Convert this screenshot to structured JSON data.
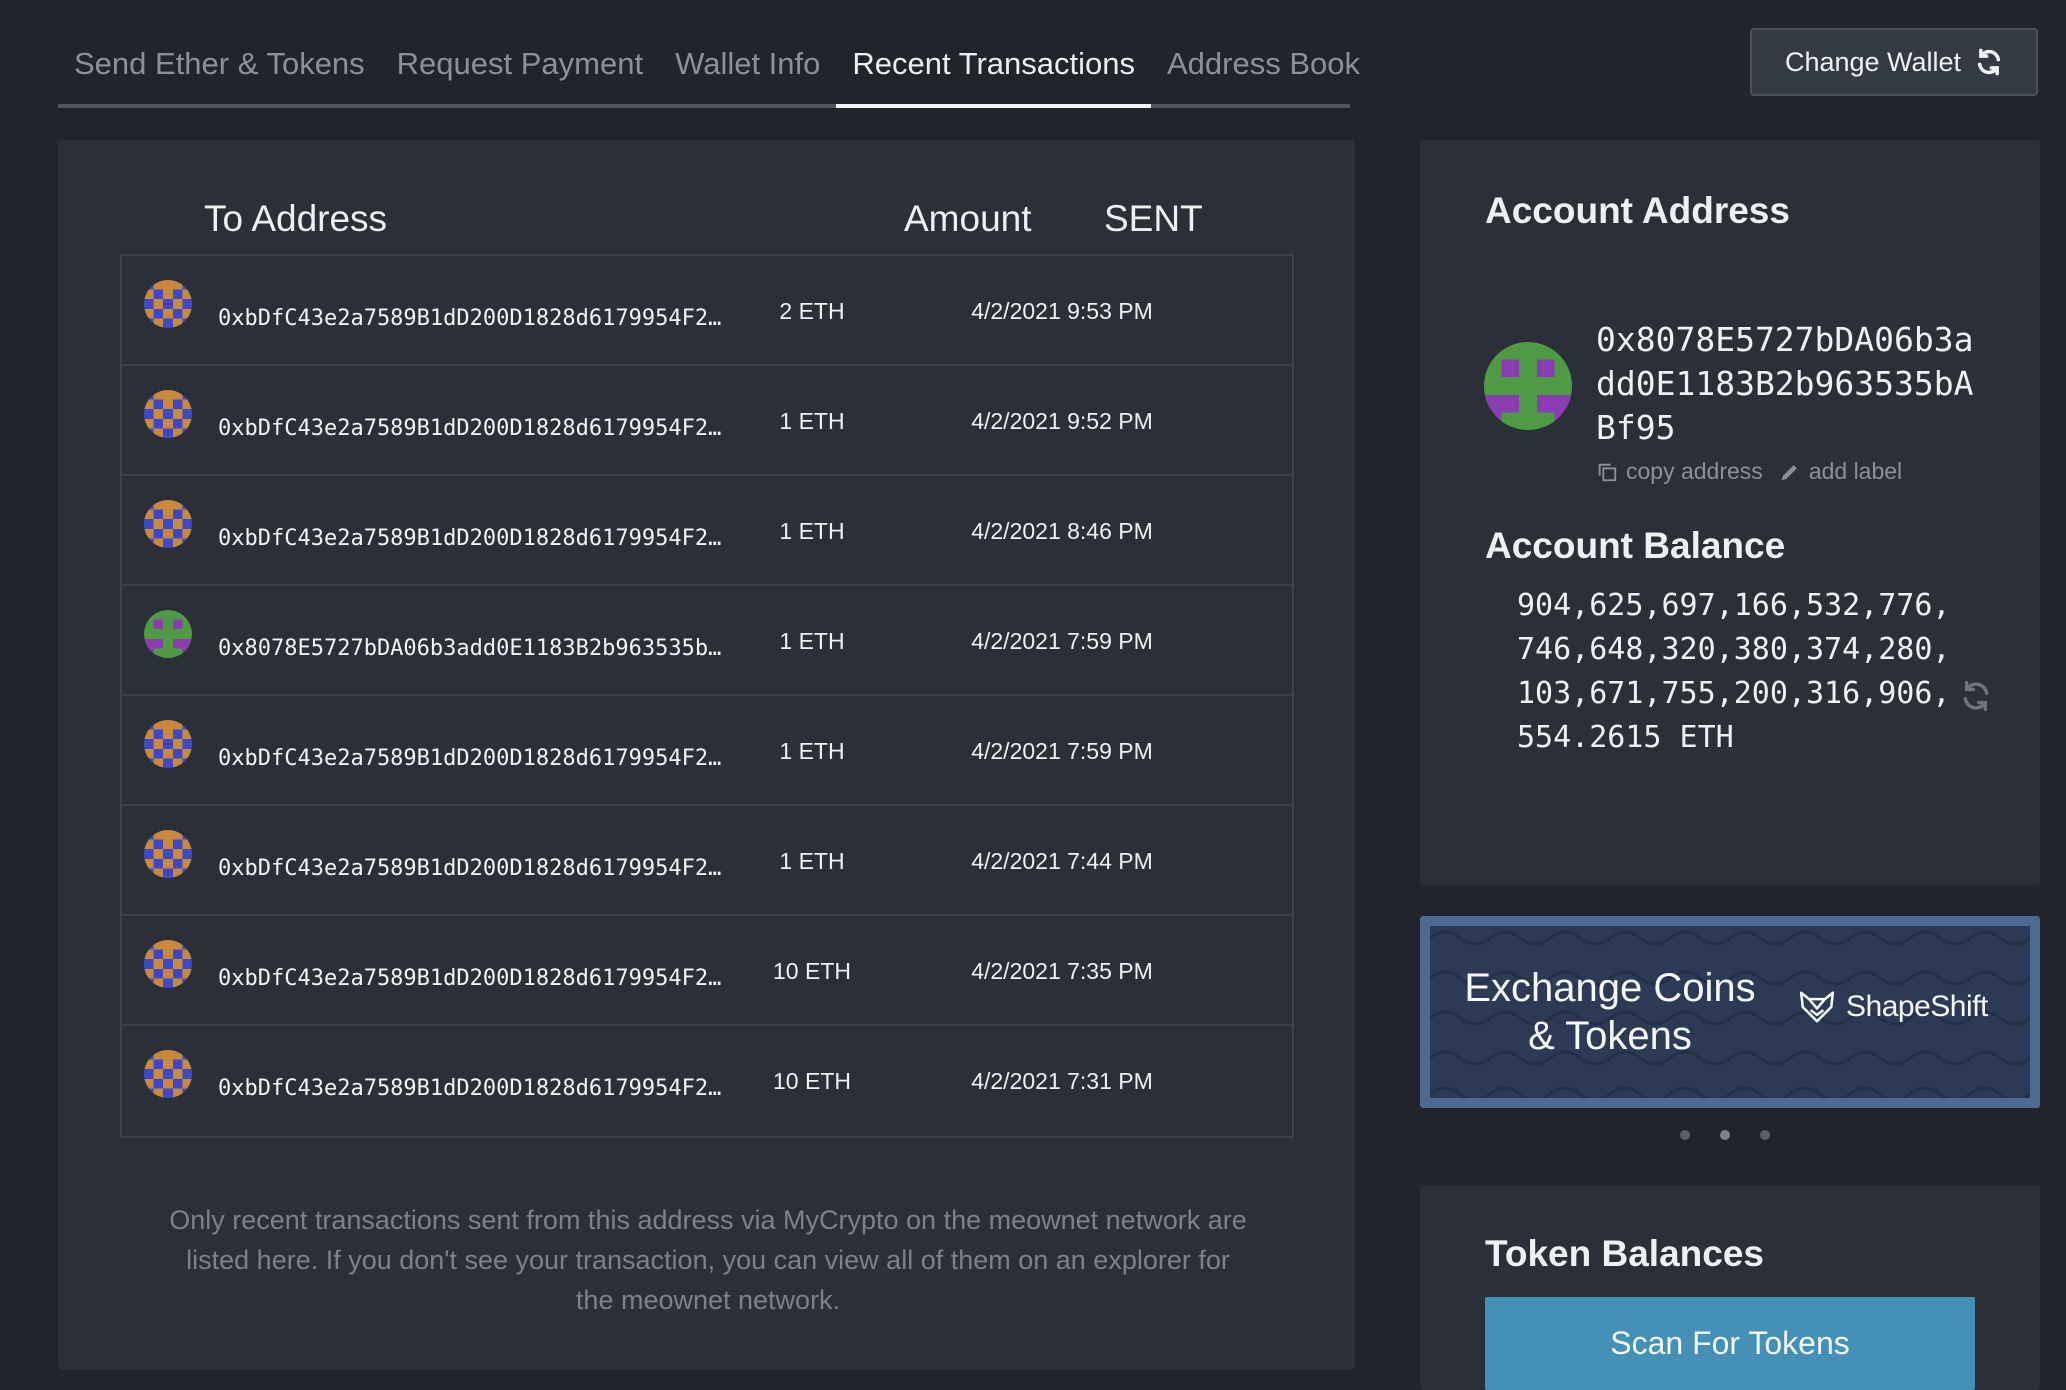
{
  "tabs": [
    {
      "label": "Send Ether & Tokens",
      "active": false
    },
    {
      "label": "Request Payment",
      "active": false
    },
    {
      "label": "Wallet Info",
      "active": false
    },
    {
      "label": "Recent Transactions",
      "active": true
    },
    {
      "label": "Address Book",
      "active": false
    }
  ],
  "change_wallet": {
    "label": "Change Wallet",
    "icon": "refresh-icon"
  },
  "transactions": {
    "headers": {
      "to": "To Address",
      "amount": "Amount",
      "sent": "SENT"
    },
    "rows": [
      {
        "identicon": "blue-orange",
        "to": "0xbDfC43e2a7589B1dD200D1828d6179954F2…",
        "amount": "2 ETH",
        "sent": "4/2/2021 9:53 PM"
      },
      {
        "identicon": "blue-orange",
        "to": "0xbDfC43e2a7589B1dD200D1828d6179954F2…",
        "amount": "1 ETH",
        "sent": "4/2/2021 9:52 PM"
      },
      {
        "identicon": "blue-orange",
        "to": "0xbDfC43e2a7589B1dD200D1828d6179954F2…",
        "amount": "1 ETH",
        "sent": "4/2/2021 8:46 PM"
      },
      {
        "identicon": "green-purple",
        "to": "0x8078E5727bDA06b3add0E1183B2b963535b…",
        "amount": "1 ETH",
        "sent": "4/2/2021 7:59 PM"
      },
      {
        "identicon": "blue-orange",
        "to": "0xbDfC43e2a7589B1dD200D1828d6179954F2…",
        "amount": "1 ETH",
        "sent": "4/2/2021 7:59 PM"
      },
      {
        "identicon": "blue-orange",
        "to": "0xbDfC43e2a7589B1dD200D1828d6179954F2…",
        "amount": "1 ETH",
        "sent": "4/2/2021 7:44 PM"
      },
      {
        "identicon": "blue-orange",
        "to": "0xbDfC43e2a7589B1dD200D1828d6179954F2…",
        "amount": "10 ETH",
        "sent": "4/2/2021 7:35 PM"
      },
      {
        "identicon": "blue-orange",
        "to": "0xbDfC43e2a7589B1dD200D1828d6179954F2…",
        "amount": "10 ETH",
        "sent": "4/2/2021 7:31 PM"
      }
    ],
    "note": "Only recent transactions sent from this address via MyCrypto on the meownet network are listed here. If you don't see your transaction, you can view all of them on an explorer for the meownet network."
  },
  "account": {
    "title": "Account Address",
    "address": "0x8078E5727bDA06b3add0E1183B2b963535bABf95",
    "copy_label": "copy address",
    "add_label": "add label",
    "balance_title": "Account Balance",
    "balance": "904,625,697,166,532,776,746,648,320,380,374,280,103,671,755,200,316,906,554.2615 ETH"
  },
  "promo": {
    "text_line1": "Exchange Coins",
    "text_line2": "& Tokens",
    "brand": "ShapeShift"
  },
  "carousel": {
    "count": 3,
    "active": 1
  },
  "tokens": {
    "title": "Token Balances",
    "scan_label": "Scan For Tokens"
  },
  "colors": {
    "background": "#21252b",
    "card": "#2b2f37",
    "accent_button": "#4490b6",
    "promo_border": "#4d6a92",
    "identicon_blue": "#3f48c9",
    "identicon_orange": "#c9893c",
    "identicon_green": "#4f9a45",
    "identicon_purple": "#8a3db0"
  }
}
